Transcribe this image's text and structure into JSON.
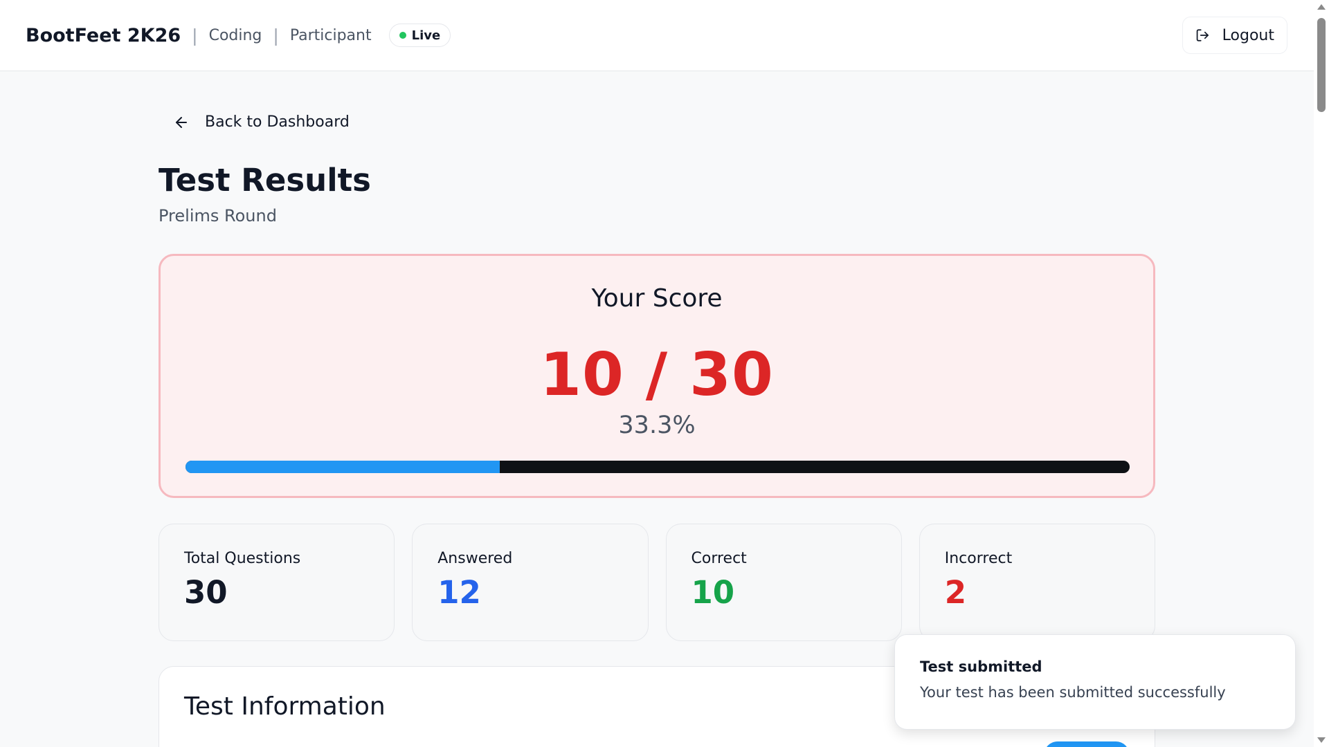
{
  "header": {
    "brand": "BootFeet 2K26",
    "breadcrumb": [
      "Coding",
      "Participant"
    ],
    "status_badge": "Live",
    "logout_label": "Logout"
  },
  "nav": {
    "back_label": "Back to Dashboard"
  },
  "page": {
    "title": "Test Results",
    "subtitle": "Prelims Round"
  },
  "score": {
    "label": "Your Score",
    "value_text": "10 / 30",
    "percent_text": "33.3%",
    "progress_fraction": 0.333
  },
  "stats": [
    {
      "label": "Total Questions",
      "value": "30",
      "color": "#111827"
    },
    {
      "label": "Answered",
      "value": "12",
      "color": "#2563eb"
    },
    {
      "label": "Correct",
      "value": "10",
      "color": "#16a34a"
    },
    {
      "label": "Incorrect",
      "value": "2",
      "color": "#dc2626"
    }
  ],
  "info": {
    "title": "Test Information"
  },
  "toast": {
    "title": "Test submitted",
    "message": "Your test has been submitted successfully"
  },
  "icons": {
    "logout": "logout-icon",
    "back": "arrow-left-icon",
    "live": "status-dot-icon"
  },
  "colors": {
    "accent": "#2196f3",
    "danger": "#dc2626",
    "success": "#16a34a",
    "info": "#2563eb"
  }
}
